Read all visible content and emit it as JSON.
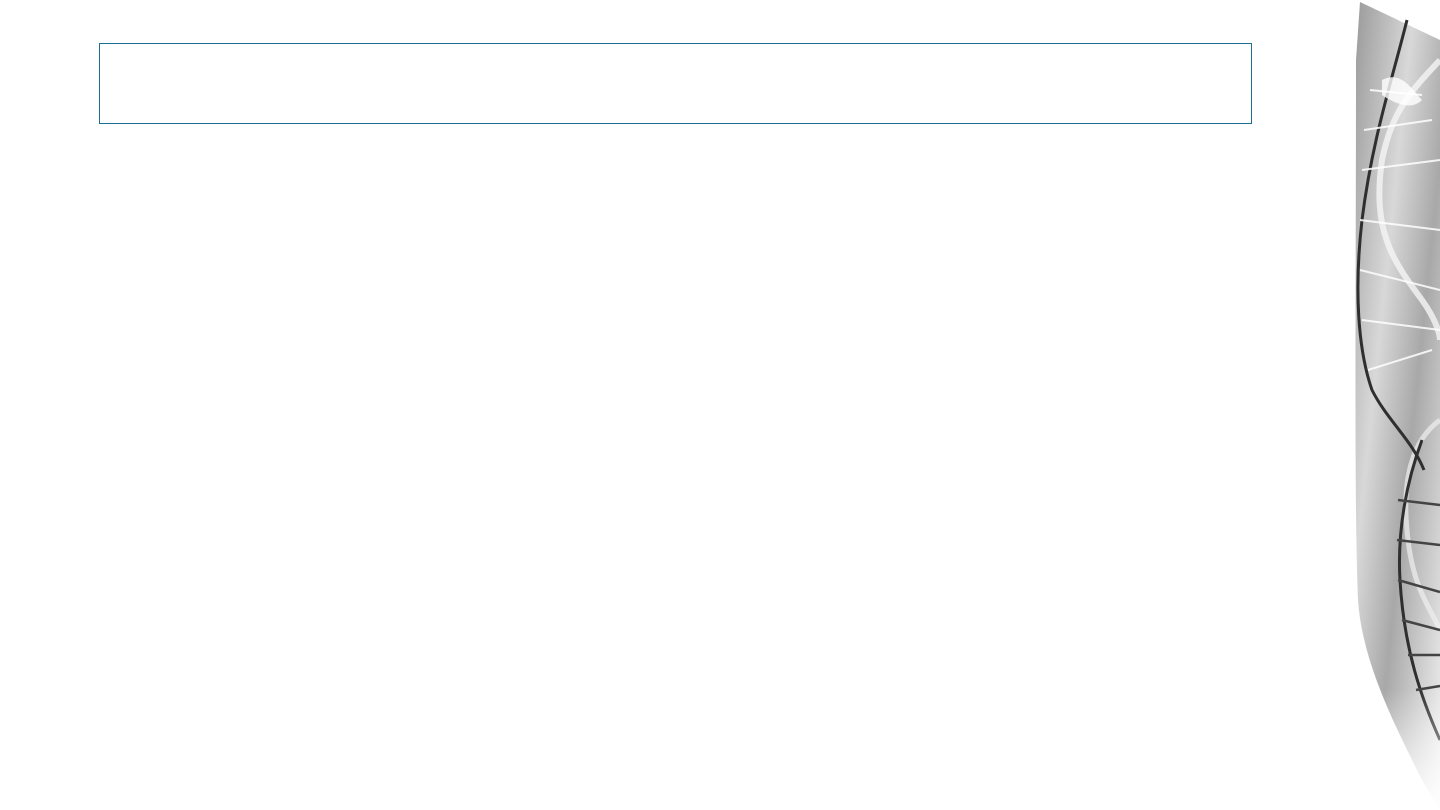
{
  "slide": {
    "title": ""
  },
  "decoration": {
    "name": "dna-helix-graphic",
    "colors": {
      "light": "#f2f2f2",
      "mid": "#b8b8b8",
      "dark": "#3a3a3a"
    }
  },
  "colors": {
    "placeholder_border": "#1b6f97",
    "background": "#ffffff"
  }
}
